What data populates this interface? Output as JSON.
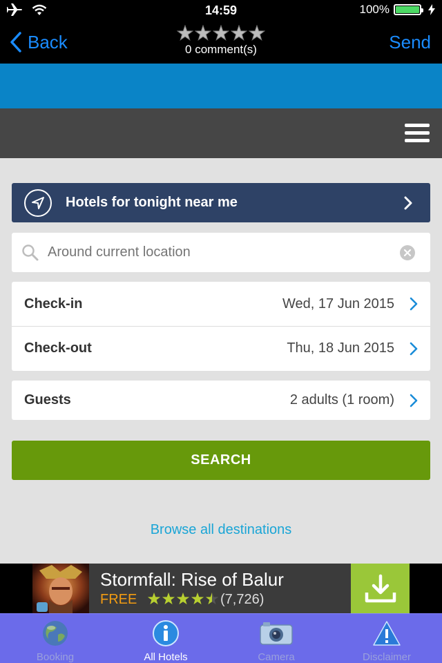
{
  "status_bar": {
    "time": "14:59",
    "battery_percent": "100%",
    "battery_level": 1.0,
    "icons": [
      "airplane-icon",
      "wifi-icon",
      "battery-icon",
      "charging-icon"
    ]
  },
  "nav": {
    "back_label": "Back",
    "send_label": "Send",
    "rating": 0,
    "rating_max": 5,
    "comments": "0 comment(s)"
  },
  "search_panel": {
    "tonight_label": "Hotels for tonight near me",
    "location_placeholder": "Around current location",
    "checkin_label": "Check-in",
    "checkin_value": "Wed, 17 Jun 2015",
    "checkout_label": "Check-out",
    "checkout_value": "Thu, 18 Jun 2015",
    "guests_label": "Guests",
    "guests_value": "2 adults (1 room)",
    "search_button": "SEARCH",
    "browse_link": "Browse all destinations"
  },
  "ad": {
    "title": "Stormfall: Rise of Balur",
    "price": "FREE",
    "rating": 4.5,
    "review_count": "(7,726)"
  },
  "tabs": [
    {
      "label": "Booking",
      "icon": "globe-icon",
      "active": false
    },
    {
      "label": "All Hotels",
      "icon": "info-icon",
      "active": true
    },
    {
      "label": "Camera",
      "icon": "camera-icon",
      "active": false
    },
    {
      "label": "Disclaimer",
      "icon": "warning-icon",
      "active": false
    }
  ],
  "colors": {
    "accent_blue": "#0a84c7",
    "dark_navy": "#2e4266",
    "search_green": "#67990b",
    "link_blue": "#1aa5d6",
    "tab_bar": "#6b6bea"
  }
}
